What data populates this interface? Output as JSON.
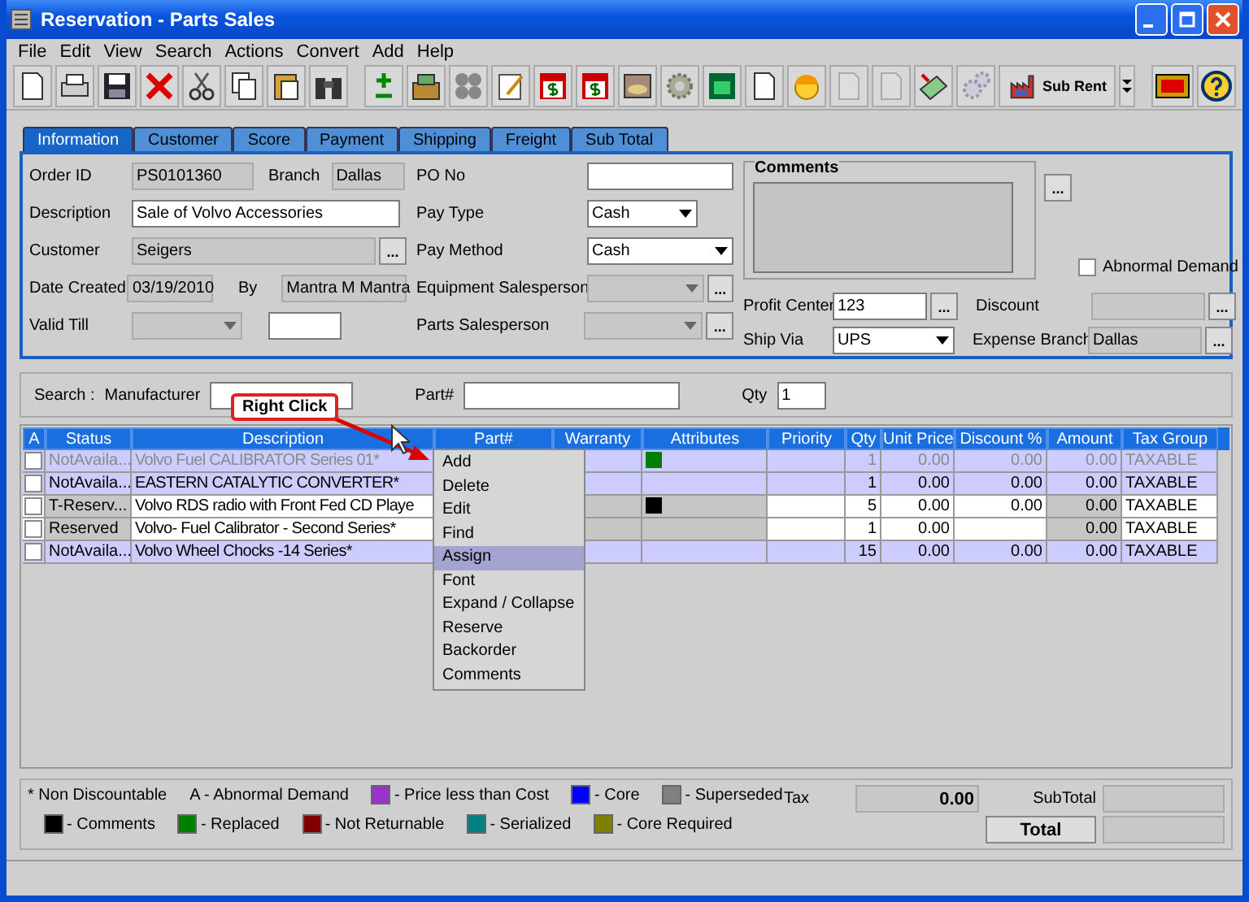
{
  "window": {
    "title": "Reservation - Parts Sales"
  },
  "menu": [
    "File",
    "Edit",
    "View",
    "Search",
    "Actions",
    "Convert",
    "Add",
    "Help"
  ],
  "toolbar": {
    "sub_rent": "Sub Rent"
  },
  "tabs": [
    {
      "label": "Information",
      "selected": true
    },
    {
      "label": "Customer",
      "selected": false
    },
    {
      "label": "Score",
      "selected": false
    },
    {
      "label": "Payment",
      "selected": false
    },
    {
      "label": "Shipping",
      "selected": false
    },
    {
      "label": "Freight",
      "selected": false
    },
    {
      "label": "Sub Total",
      "selected": false
    }
  ],
  "form": {
    "order_id": {
      "label": "Order ID",
      "value": "PS0101360",
      "disabled": true
    },
    "branch": {
      "label": "Branch",
      "value": "Dallas",
      "disabled": true
    },
    "description": {
      "label": "Description",
      "value": "Sale of Volvo Accessories",
      "disabled": false
    },
    "customer": {
      "label": "Customer",
      "value": "Seigers",
      "disabled": true,
      "lookup": "..."
    },
    "date_created": {
      "label": "Date Created",
      "value": "03/19/2010",
      "disabled": true
    },
    "by": {
      "label": "By",
      "value": "Mantra M Mantra",
      "disabled": true
    },
    "valid_till": {
      "label": "Valid Till",
      "disabled": true
    },
    "valid_till_extra": {
      "disabled": false
    },
    "po_no": {
      "label": "PO No",
      "disabled": false
    },
    "pay_type": {
      "label": "Pay Type",
      "value": "Cash",
      "disabled": false
    },
    "pay_method": {
      "label": "Pay Method",
      "value": "Cash",
      "disabled": false
    },
    "equipment_salesperson": {
      "label": "Equipment Salesperson",
      "disabled": true,
      "lookup": "..."
    },
    "parts_salesperson": {
      "label": "Parts Salesperson",
      "disabled": true,
      "lookup": "..."
    },
    "comments": {
      "title": "Comments",
      "disabled": true,
      "lookup": "..."
    },
    "abnormal_demand": {
      "label": "Abnormal Demand",
      "checked": false
    },
    "profit_center": {
      "label": "Profit Center",
      "value": "123",
      "disabled": false,
      "lookup": "..."
    },
    "discount": {
      "label": "Discount",
      "disabled": true,
      "lookup": "..."
    },
    "ship_via": {
      "label": "Ship Via",
      "value": "UPS",
      "disabled": false
    },
    "expense_branch": {
      "label": "Expense Branch",
      "value": "Dallas",
      "disabled": true,
      "lookup": "..."
    }
  },
  "search": {
    "label": "Search :",
    "manufacturer": "Manufacturer",
    "part": "Part#",
    "qty": "Qty",
    "qty_value": "1"
  },
  "table": {
    "columns": [
      "A",
      "Status",
      "Description",
      "Part#",
      "Warranty",
      "Attributes",
      "Priority",
      "Qty",
      "Unit Price",
      "Discount %",
      "Amount",
      "Tax Group"
    ],
    "rows": [
      {
        "kind": "not_available",
        "disabled": true,
        "checked": false,
        "status": "NotAvaila...",
        "description": "Volvo Fuel CALIBRATOR Series 01*",
        "color": "#008000",
        "qty": "1",
        "unit_price": "0.00",
        "discount": "0.00",
        "amount": "0.00",
        "tax_group": "TAXABLE"
      },
      {
        "kind": "not_available",
        "disabled": false,
        "checked": false,
        "status": "NotAvaila...",
        "description": "EASTERN CATALYTIC CONVERTER*",
        "qty": "1",
        "unit_price": "0.00",
        "discount": "0.00",
        "amount": "0.00",
        "tax_group": "TAXABLE"
      },
      {
        "kind": "reserved",
        "disabled": false,
        "checked": false,
        "status": "T-Reserv...",
        "description": "Volvo RDS radio with Front Fed CD Playe",
        "color": "#000000",
        "qty": "5",
        "unit_price": "0.00",
        "discount": "0.00",
        "amount": "0.00",
        "tax_group": "TAXABLE"
      },
      {
        "kind": "reserved",
        "disabled": false,
        "checked": false,
        "status": "Reserved",
        "description": "Volvo- Fuel Calibrator - Second Series*",
        "qty": "1",
        "unit_price": "0.00",
        "amount": "0.00",
        "tax_group": "TAXABLE"
      },
      {
        "kind": "not_available",
        "disabled": false,
        "checked": false,
        "status": "NotAvaila...",
        "description": "Volvo Wheel Chocks -14 Series*",
        "qty": "15",
        "unit_price": "0.00",
        "discount": "0.00",
        "amount": "0.00",
        "tax_group": "TAXABLE"
      }
    ]
  },
  "context_menu": [
    {
      "label": "Add",
      "selected": false
    },
    {
      "label": "Delete",
      "selected": false
    },
    {
      "label": "Edit",
      "selected": false
    },
    {
      "label": "Find",
      "selected": false
    },
    {
      "label": "Assign",
      "selected": true
    },
    {
      "label": "Font",
      "selected": false
    },
    {
      "label": "Expand / Collapse",
      "selected": false
    },
    {
      "label": "Reserve",
      "selected": false
    },
    {
      "label": "Backorder",
      "selected": false
    },
    {
      "label": "Comments",
      "selected": false
    }
  ],
  "callout": "Right Click",
  "legend": [
    {
      "items": [
        {
          "label": "* Non Discountable"
        },
        {
          "label": "A - Abnormal Demand"
        },
        {
          "label": "- Price less than Cost",
          "color": "#9933cc"
        },
        {
          "label": "- Core",
          "color": "#0000ff"
        },
        {
          "label": "- Superseded",
          "color": "#808080"
        }
      ]
    },
    {
      "items": [
        {
          "label": "- Comments",
          "color": "#000000"
        },
        {
          "label": "- Replaced",
          "color": "#008000"
        },
        {
          "label": "- Not Returnable",
          "color": "#800000"
        },
        {
          "label": "- Serialized",
          "color": "#008080"
        },
        {
          "label": "- Core Required",
          "color": "#808000"
        }
      ]
    }
  ],
  "totals": {
    "tax_label": "Tax",
    "tax": "0.00",
    "subtotal_label": "SubTotal",
    "total_button": "Total"
  }
}
